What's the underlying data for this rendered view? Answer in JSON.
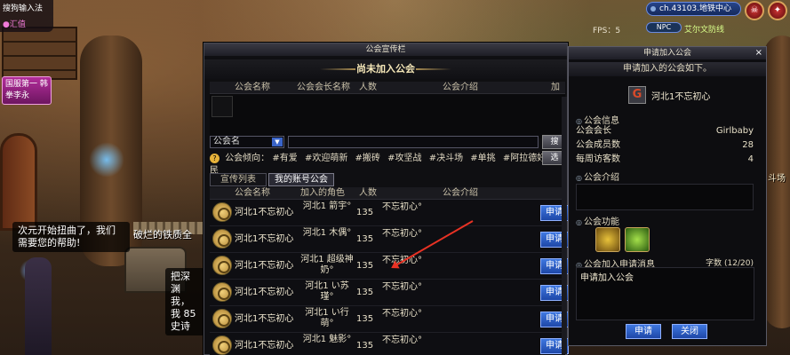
{
  "hud": {
    "ime_label": "搜狗输入法",
    "ime_status": "●汇值",
    "server_badge": "国服第一 韩拳李永",
    "channel": "ch.43103.地铁中心",
    "fps_label": "FPS：5",
    "npc_label": "NPC",
    "map_name": "艾尔文防线"
  },
  "scene": {
    "bubble_1": "次元开始扭曲了，我们需要您的帮助!",
    "scene_text_1": "破烂的铁质全",
    "scene_text_2": "把深渊 我，我 85史诗",
    "right_edge": "斗场"
  },
  "guild_window": {
    "title": "公会宣传栏",
    "section_title": "尚未加入公会",
    "top_columns": [
      "公会名称",
      "公会会长名称",
      "人数",
      "公会介绍",
      "加入"
    ],
    "search_select": "公会名",
    "search_button": "搜",
    "tendency_label": "公会倾向：",
    "tendency_tags": [
      "#有爱",
      "#欢迎萌新",
      "#搬砖",
      "#攻坚战",
      "#决斗场",
      "#单挑",
      "#阿拉德好公民"
    ],
    "tendency_button": "选",
    "tabs": [
      "宣传列表",
      "我的账号公会"
    ],
    "list_columns": [
      "公会名称",
      "加入的角色",
      "人数",
      "公会介绍"
    ],
    "rows": [
      {
        "name": "河北1不忘初心",
        "role": "河北1 箭宇°",
        "count": "135",
        "intro": "不忘初心°",
        "apply": "申请"
      },
      {
        "name": "河北1不忘初心",
        "role": "河北1 木偶°",
        "count": "135",
        "intro": "不忘初心°",
        "apply": "申请"
      },
      {
        "name": "河北1不忘初心",
        "role": "河北1 超级神奶°",
        "count": "135",
        "intro": "不忘初心°",
        "apply": "申请"
      },
      {
        "name": "河北1不忘初心",
        "role": "河北1 い苏瑾°",
        "count": "135",
        "intro": "不忘初心°",
        "apply": "申请"
      },
      {
        "name": "河北1不忘初心",
        "role": "河北1 い行萌°",
        "count": "135",
        "intro": "不忘初心°",
        "apply": "申请"
      },
      {
        "name": "河北1不忘初心",
        "role": "河北1 魅影°",
        "count": "135",
        "intro": "不忘初心°",
        "apply": "申请"
      }
    ]
  },
  "apply_window": {
    "title": "申请加入公会",
    "subtitle": "申请加入的公会如下。",
    "guild_icon_letter": "G",
    "guild_name": "河北1不忘初心",
    "info_label": "公会信息",
    "leader_label": "公会会长",
    "leader_value": "Girlbaby",
    "members_label": "公会成员数",
    "members_value": "28",
    "visitors_label": "每周访客数",
    "visitors_value": "4",
    "intro_label": "公会介绍",
    "function_label": "公会功能",
    "message_label": "公会加入申请消息",
    "message_count": "字数 (12/20)",
    "message_text": "申请加入公会",
    "apply_button": "申请",
    "close_button": "关闭"
  }
}
